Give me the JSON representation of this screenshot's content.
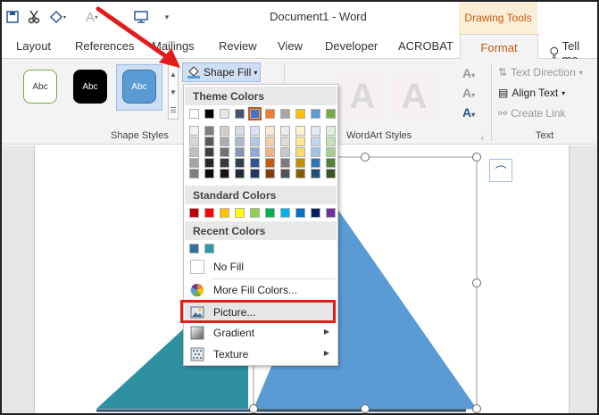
{
  "titlebar": {
    "doc_title": "Document1 - Word",
    "drawing_tools": "Drawing Tools",
    "qat_icons": [
      "save-icon",
      "cut-icon",
      "format-painter-icon",
      "font-color-icon",
      "screen-icon",
      "customize-icon"
    ]
  },
  "tabs": {
    "items": [
      "Layout",
      "References",
      "Mailings",
      "Review",
      "View",
      "Developer",
      "ACROBAT"
    ],
    "active": "Format",
    "tell_me": "Tell me"
  },
  "ribbon": {
    "shape_styles": {
      "thumbs": [
        "Abc",
        "Abc",
        "Abc"
      ],
      "label": "Shape Styles"
    },
    "shape_fill_label": "Shape Fill",
    "wordart_label": "WordArt Styles",
    "wordart_letters": [
      "A",
      "A"
    ],
    "text_group": {
      "text_direction": "Text Direction",
      "align_text": "Align Text",
      "create_link": "Create Link",
      "label": "Text"
    }
  },
  "menu": {
    "theme_colors_header": "Theme Colors",
    "standard_colors_header": "Standard Colors",
    "recent_colors_header": "Recent Colors",
    "theme_top_row": [
      "#ffffff",
      "#000000",
      "#e7e6e6",
      "#44546a",
      "#4472c4",
      "#ed7d31",
      "#a5a5a5",
      "#ffc000",
      "#5b9bd5",
      "#70ad47"
    ],
    "theme_shades": [
      [
        "#f2f2f2",
        "#7f7f7f",
        "#d0cece",
        "#d6dce4",
        "#d9e2f3",
        "#fbe5d5",
        "#ededed",
        "#fff2cc",
        "#deebf6",
        "#e2efd9"
      ],
      [
        "#d8d8d8",
        "#595959",
        "#aeabab",
        "#adb9ca",
        "#b4c6e7",
        "#f7cbac",
        "#dbdbdb",
        "#fee599",
        "#bdd7ee",
        "#c5e0b3"
      ],
      [
        "#bfbfbf",
        "#3f3f3f",
        "#757070",
        "#8496b0",
        "#8eaadb",
        "#f4b183",
        "#c9c9c9",
        "#ffd965",
        "#9cc3e5",
        "#a8d08d"
      ],
      [
        "#a5a5a5",
        "#262626",
        "#3a3838",
        "#323f4f",
        "#2f5496",
        "#c55a11",
        "#7b7b7b",
        "#bf9000",
        "#2e75b5",
        "#538135"
      ],
      [
        "#7f7f7f",
        "#0c0c0c",
        "#171616",
        "#222a35",
        "#1f3864",
        "#833c0b",
        "#525252",
        "#7f6000",
        "#1e4e79",
        "#375623"
      ]
    ],
    "standard": [
      "#c00000",
      "#ff0000",
      "#ffc000",
      "#ffff00",
      "#92d050",
      "#00b050",
      "#00b0f0",
      "#0070c0",
      "#002060",
      "#7030a0"
    ],
    "recent": [
      "#2e6fa3",
      "#2a9aa8"
    ],
    "no_fill": "No Fill",
    "more_fill_colors": "More Fill Colors...",
    "picture": "Picture...",
    "gradient": "Gradient",
    "texture": "Texture"
  },
  "colors": {
    "teal_triangle": "#2d91a2",
    "blue_triangle": "#5b9bd5",
    "accent": "#c55a11",
    "annotation_red": "#e41b1b"
  }
}
